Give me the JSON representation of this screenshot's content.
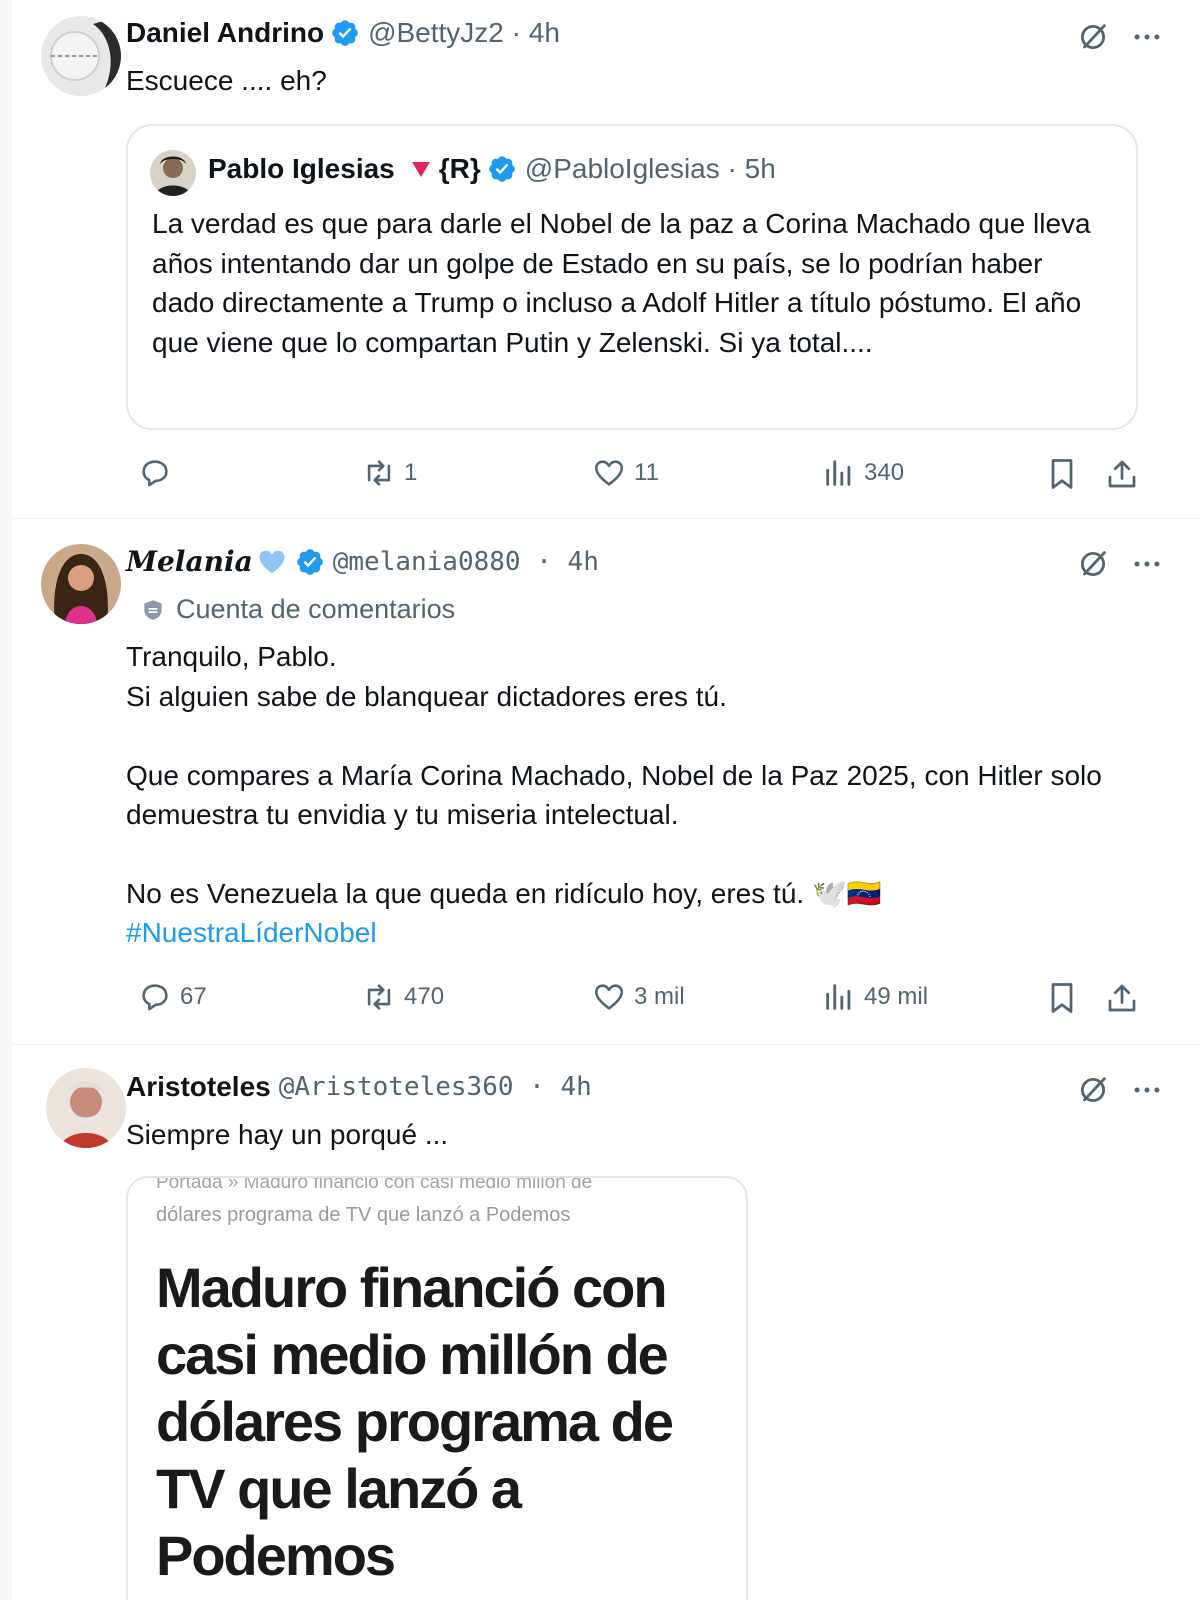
{
  "tweets": [
    {
      "author": "Daniel Andrino",
      "handle": "@BettyJz2 · 4h",
      "text": "Escuece ....     eh?",
      "quote": {
        "author": "Pablo Iglesias",
        "badges": "{R}",
        "handle": "@PabloIglesias · 5h",
        "text": "La verdad es que para darle el Nobel de la paz a Corina Machado que lleva años intentando dar un golpe de Estado en su país, se lo podrían haber dado directamente a Trump o incluso a Adolf Hitler a título póstumo. El año que viene que lo compartan Putin y Zelenski. Si ya total...."
      },
      "stats": {
        "replies": "",
        "reposts": "1",
        "likes": "11",
        "views": "340"
      }
    },
    {
      "author": "Melania",
      "handle": "@melania0880 · 4h",
      "label": "Cuenta de comentarios",
      "text": "Tranquilo, Pablo.\nSi alguien sabe de blanquear dictadores eres tú.\n\nQue compares a María Corina Machado, Nobel de la Paz 2025, con Hitler solo demuestra tu envidia y tu miseria intelectual.\n\nNo es Venezuela la que queda en ridículo hoy, eres tú. 🕊️🇻🇪",
      "hashtag": "#NuestraLíderNobel",
      "stats": {
        "replies": "67",
        "reposts": "470",
        "likes": "3 mil",
        "views": "49 mil"
      }
    },
    {
      "author": "Aristoteles",
      "handle": "@Aristoteles360 · 4h",
      "text": "Siempre hay un porqué ...",
      "article": {
        "breadcrumb_top": "Portada » Maduro financió con casi medio millón de",
        "breadcrumb": "dólares programa de TV que lanzó a Podemos",
        "headline": "Maduro financió con casi medio millón de dólares programa de TV que lanzó a Podemos"
      }
    }
  ],
  "colors": {
    "text": "#0f1419",
    "secondary": "#536471",
    "verified": "#1d9bf0",
    "link": "#1d9bf0",
    "border": "#e1e8ed",
    "emoji_heart": "#8ec5f5",
    "red_triangle": "#e0245e"
  },
  "icons": [
    "verified-badge-icon",
    "grok-icon",
    "more-icon",
    "reply-icon",
    "repost-icon",
    "like-icon",
    "views-icon",
    "bookmark-icon",
    "share-icon",
    "shield-icon"
  ]
}
